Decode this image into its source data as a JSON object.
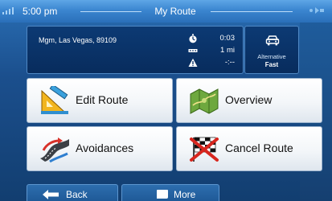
{
  "status_bar": {
    "time": "5:00 pm",
    "title": "My Route"
  },
  "route_summary": {
    "address": "Mgm, Las Vegas, 89109",
    "duration": "0:03",
    "distance": "1 mi",
    "warning_value": "-:--"
  },
  "alternative": {
    "label": "Alternative",
    "mode": "Fast"
  },
  "menu": {
    "edit_route": "Edit Route",
    "overview": "Overview",
    "avoidances": "Avoidances",
    "cancel_route": "Cancel Route"
  },
  "bottom_bar": {
    "back": "Back",
    "more": "More"
  },
  "icons": {
    "edit_route": "ruler-triangle-icon",
    "overview": "map-icon",
    "avoidances": "road-icon",
    "cancel_route": "checkered-flag-cancel-icon",
    "alternative": "car-icon",
    "duration": "stopwatch-icon",
    "distance": "distance-icon",
    "warning": "warning-icon"
  },
  "colors": {
    "screen_background": "#1b4f8d",
    "status_bar": "#3b86d0",
    "panel": "#0a326a",
    "tile": "#f3f6f9",
    "button": "#2463a3"
  }
}
